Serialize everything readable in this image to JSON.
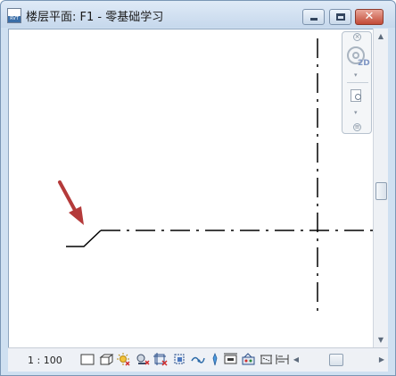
{
  "window": {
    "title": "楼层平面: F1 - 零基础学习",
    "app_icon": "revit-rvt-icon",
    "buttons": {
      "minimize": "minimize-icon",
      "maximize": "maximize-icon",
      "close": "close-icon",
      "close_glyph": "✕"
    }
  },
  "canvas": {
    "background": "#ffffff",
    "drawing": "grid-lines-dash-dot",
    "annotation": "red-arrow-icon",
    "arrow_color": "#b43a3a"
  },
  "navigation_bar": {
    "close_glyph": "×",
    "wheel_label": "2D",
    "caret": "▾",
    "bottom_glyph": "≡",
    "tools": [
      "2d-steering-wheel-icon",
      "zoom-region-icon"
    ]
  },
  "status_bar": {
    "scale": "1 : 100",
    "icons": [
      "detail-level-icon",
      "visual-style-icon",
      "sun-path-icon",
      "shadows-icon",
      "crop-view-icon",
      "show-crop-region-icon",
      "unlocked-3d-view-icon",
      "temporary-hide-isolate-icon",
      "reveal-hidden-elements-icon",
      "worksharing-display-icon",
      "analytical-model-icon",
      "highlight-displacement-icon"
    ]
  },
  "scroll": {
    "up": "▲",
    "down": "▼",
    "left": "◀",
    "right": "▶"
  }
}
